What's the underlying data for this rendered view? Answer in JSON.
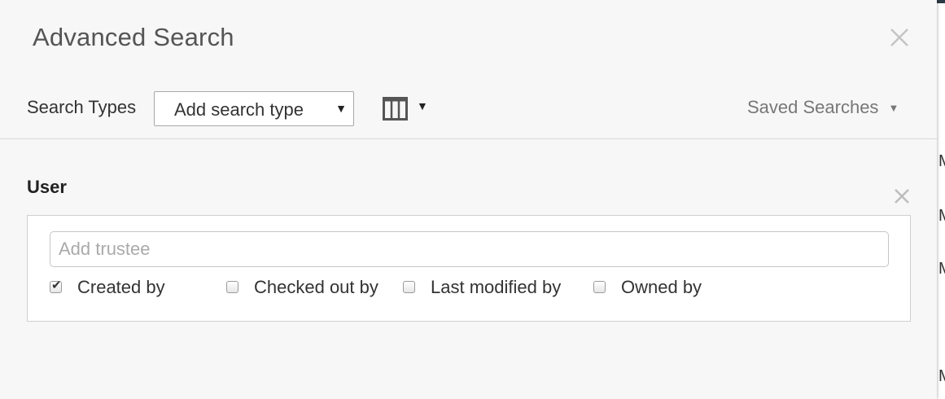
{
  "dialog": {
    "title": "Advanced Search",
    "close_icon": "close-icon"
  },
  "toolbar": {
    "search_types_label": "Search Types",
    "search_type_select": {
      "value": "Add search type",
      "arrow_icon": "triangle-down-icon"
    },
    "columns_button": {
      "icon": "columns-icon",
      "caret_icon": "triangle-down-icon"
    },
    "saved_searches": {
      "label": "Saved Searches",
      "caret_icon": "triangle-down-icon"
    }
  },
  "user_section": {
    "title": "User",
    "remove_icon": "close-icon",
    "trustee_input": {
      "value": "",
      "placeholder": "Add trustee"
    },
    "checkboxes": [
      {
        "label": "Created by",
        "checked": true
      },
      {
        "label": "Checked out by",
        "checked": false
      },
      {
        "label": "Last modified by",
        "checked": false
      },
      {
        "label": "Owned by",
        "checked": false
      }
    ]
  },
  "colors": {
    "dialog_background": "#f7f7f7",
    "title_text": "#555555",
    "muted_text": "#777777",
    "panel_border": "#cfcfcf",
    "placeholder_text": "#aaaaaa"
  }
}
